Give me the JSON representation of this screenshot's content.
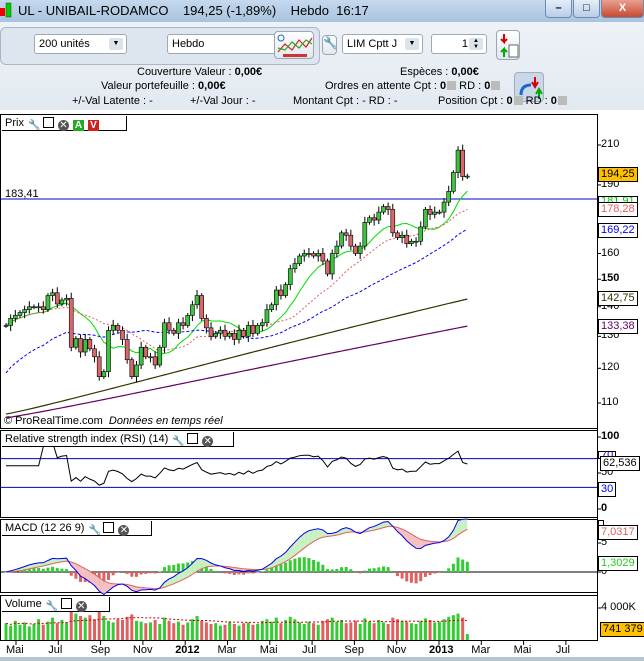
{
  "window": {
    "title": "UL - UNIBAIL-RODAMCO",
    "price": "194,25 (-1,89%)",
    "period": "Hebdo",
    "time": "16:17",
    "minimize": "–",
    "maximize": "□",
    "close": "X"
  },
  "toolbar": {
    "units": "200 unités",
    "timeframe": "Hebdo",
    "order_type": "LIM Cptt J",
    "quantity": "1"
  },
  "account": {
    "couverture_label": "Couverture Valeur :",
    "couverture_value": "0,00€",
    "especes_label": "Espèces :",
    "especes_value": "0,00€",
    "portefeuille_label": "Valeur portefeuille :",
    "portefeuille_value": "0,00€",
    "ordres_label": "Ordres en attente Cpt :",
    "ordres_cpt": "0",
    "ordres_rd_label": "RD :",
    "ordres_rd": "0",
    "latente_label": "+/-Val Latente :",
    "latente_value": "-",
    "jour_label": "+/-Val Jour :",
    "jour_value": "-",
    "montant_label": "Montant Cpt : - RD : -",
    "position_label": "Position Cpt :",
    "position_cpt": "0",
    "position_rd_label": "RD :",
    "position_rd": "0"
  },
  "colors": {
    "up": "#3fc23f",
    "down": "#d9666a",
    "ma_green": "#00dd00",
    "ma_red": "#e06060",
    "ma_blue": "#0000ee",
    "ma_olive": "#333300",
    "ma_purple": "#660066",
    "last_price_bg": "#ffc000",
    "hline": "#0000cc"
  },
  "price_panel": {
    "title": "Prix",
    "hline_value": 183.41,
    "hline_label": "183,41",
    "watermark": "© ProRealTime.com",
    "watermark2": "Données en temps réel",
    "axis_ticks": [
      "210",
      "190",
      "160",
      "150",
      "140",
      "130",
      "120",
      "110"
    ],
    "last_price": "194,25",
    "ma_labels": [
      "181,91",
      "178,28",
      "169,22",
      "142,75",
      "133,38"
    ],
    "scale": "log",
    "ylim": [
      106,
      215
    ]
  },
  "rsi_panel": {
    "title": "Relative strength index (RSI) (14)",
    "axis_ticks": [
      "100",
      "50",
      "0"
    ],
    "levels": [
      70,
      30
    ],
    "level_labels": [
      "70",
      "30"
    ],
    "last": "62,536"
  },
  "macd_panel": {
    "title": "MACD (12 26 9)",
    "axis_ticks": [
      "5",
      "0"
    ],
    "macd_last": "7,0317",
    "hist_last": "1,3029"
  },
  "volume_panel": {
    "title": "Volume",
    "axis_ticks": [
      "4 000K"
    ],
    "last": "741 379"
  },
  "x_axis": [
    "Mai",
    "Jul",
    "Sep",
    "Nov",
    "2012",
    "Mar",
    "Mai",
    "Jul",
    "Sep",
    "Nov",
    "2013",
    "Mar",
    "Mai",
    "Jul"
  ],
  "chart_data": {
    "type": "candlestick",
    "closes": [
      133.6,
      136,
      137,
      138,
      139,
      140,
      140,
      140,
      139,
      144,
      145,
      141,
      142.4,
      143,
      126.5,
      129.3,
      125,
      129,
      126,
      123.5,
      117.5,
      119,
      132,
      133.6,
      132,
      129,
      122.6,
      117.5,
      121,
      126.5,
      123.5,
      123.5,
      121,
      126.5,
      134.5,
      132,
      131,
      134.5,
      133.6,
      137,
      140.7,
      144,
      136,
      132.8,
      130,
      131,
      132,
      130,
      131,
      129,
      132,
      130,
      133.6,
      131,
      133.6,
      134.5,
      139,
      140.7,
      146,
      144,
      148,
      154,
      156,
      159,
      160,
      160,
      159,
      160,
      157,
      152,
      160,
      163,
      168.5,
      167.5,
      163,
      160,
      163,
      173,
      175,
      174,
      177.5,
      180,
      178.7,
      168.5,
      166.5,
      167.5,
      164,
      165,
      165,
      171,
      178.7,
      176.5,
      177.5,
      177.5,
      182,
      187,
      196,
      207.3,
      194,
      194.25
    ],
    "volume_k": [
      2100,
      1800,
      2400,
      1900,
      2200,
      1700,
      2000,
      2600,
      1900,
      2300,
      2800,
      2100,
      2500,
      2200,
      4600,
      3300,
      3000,
      2800,
      3100,
      2600,
      3500,
      3000,
      2400,
      2200,
      2600,
      2500,
      2900,
      3200,
      2400,
      2300,
      2100,
      2200,
      2500,
      2000,
      2800,
      2400,
      2100,
      2300,
      1900,
      2200,
      2600,
      3000,
      2400,
      2200,
      2000,
      2100,
      1800,
      1900,
      2300,
      2000,
      1800,
      2100,
      2200,
      1900,
      2000,
      2400,
      2600,
      2300,
      2800,
      2100,
      2500,
      2900,
      2600,
      2200,
      2000,
      2300,
      2100,
      1900,
      2400,
      2600,
      2800,
      2300,
      2500,
      2100,
      2200,
      2400,
      2000,
      2700,
      2300,
      2100,
      2500,
      2200,
      2000,
      2800,
      2600,
      2400,
      2300,
      2100,
      2000,
      2400,
      2700,
      2500,
      2200,
      2300,
      2600,
      2900,
      3100,
      3300,
      2800,
      741.379
    ],
    "ma_long": [
      {
        "name": "",
        "start": 107,
        "end": 142.75
      },
      {
        "name": "",
        "start": 106,
        "end": 133.38
      }
    ]
  }
}
